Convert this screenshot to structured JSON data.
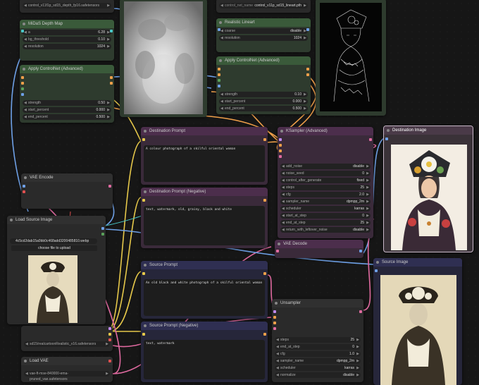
{
  "nodes": {
    "depth_loader": {
      "model": "control_v11f1p_sd15_depth_fp16.safetensors"
    },
    "midas": {
      "title": "MiDaS Depth Map",
      "a": {
        "label": "a",
        "value": "6.28"
      },
      "bg_threshold": {
        "label": "bg_threshold",
        "value": "0.10"
      },
      "resolution": {
        "label": "resolution",
        "value": "1024"
      }
    },
    "apply_cn_1": {
      "title": "Apply ControlNet (Advanced)",
      "strength": {
        "label": "strength",
        "value": "0.50"
      },
      "start_percent": {
        "label": "start_percent",
        "value": "0.000"
      },
      "end_percent": {
        "label": "end_percent",
        "value": "0.500"
      }
    },
    "lineart_loader": {
      "label": "control_net_name",
      "model": "control_v11p_sd15_lineart.pth"
    },
    "realistic_lineart": {
      "title": "Realistic Lineart",
      "coarse": {
        "label": "coarse",
        "value": "disable"
      },
      "resolution": {
        "label": "resolution",
        "value": "1024"
      }
    },
    "apply_cn_2": {
      "title": "Apply ControlNet (Advanced)",
      "strength": {
        "label": "strength",
        "value": "0.10"
      },
      "start_percent": {
        "label": "start_percent",
        "value": "0.000"
      },
      "end_percent": {
        "label": "end_percent",
        "value": "0.500"
      }
    },
    "dest_prompt": {
      "title": "Destination Prompt",
      "text": "A colour photograph of a skilful oriental woman"
    },
    "dest_neg": {
      "title": "Destination Prompt (Negative)",
      "text": "text, watermark, old, grainy, black and white"
    },
    "src_prompt": {
      "title": "Source Prompt",
      "text": "An old black and white photograph of a skilful oriental woman"
    },
    "src_neg": {
      "title": "Source Prompt (Negative)",
      "text": "text, watermark"
    },
    "ksampler": {
      "title": "KSampler (Advanced)",
      "rows": [
        {
          "label": "add_noise",
          "value": "disable"
        },
        {
          "label": "noise_seed",
          "value": "0"
        },
        {
          "label": "control_after_generate",
          "value": "fixed"
        },
        {
          "label": "steps",
          "value": "25"
        },
        {
          "label": "cfg",
          "value": "2.0"
        },
        {
          "label": "sampler_name",
          "value": "dpmpp_2m"
        },
        {
          "label": "scheduler",
          "value": "karras"
        },
        {
          "label": "start_at_step",
          "value": "0"
        },
        {
          "label": "end_at_step",
          "value": "25"
        },
        {
          "label": "return_with_leftover_noise",
          "value": "disable"
        }
      ]
    },
    "vae_encode": {
      "title": "VAE Encode"
    },
    "vae_decode": {
      "title": "VAE Decode"
    },
    "load_source": {
      "title": "Load Source Image",
      "file": "4c5cd2dab15a0bb0c468add3200485810.webp",
      "button": "choose file to upload"
    },
    "dest_image": {
      "title": "Destination Image"
    },
    "source_image": {
      "title": "Source Image"
    },
    "unsampler": {
      "title": "Unsampler",
      "rows": [
        {
          "label": "steps",
          "value": "25"
        },
        {
          "label": "end_at_step",
          "value": "0"
        },
        {
          "label": "cfg",
          "value": "1.0"
        },
        {
          "label": "sampler_name",
          "value": "dpmpp_2m"
        },
        {
          "label": "scheduler",
          "value": "karras"
        },
        {
          "label": "normalize",
          "value": "disable"
        }
      ]
    },
    "checkpoint": {
      "model": "sd15/realcartoonRealistic_v16.safetensors"
    },
    "load_vae": {
      "title": "Load VAE",
      "model": "vae-ft-mse-840000-ema-pruned_vae.safetensors"
    }
  },
  "colors": {
    "wire_blue": "#6ea0e6",
    "wire_yellow": "#e6c84a",
    "wire_orange": "#f0a04a",
    "wire_pink": "#e06aa0",
    "wire_teal": "#4ac8c8",
    "wire_red": "#e05050"
  }
}
